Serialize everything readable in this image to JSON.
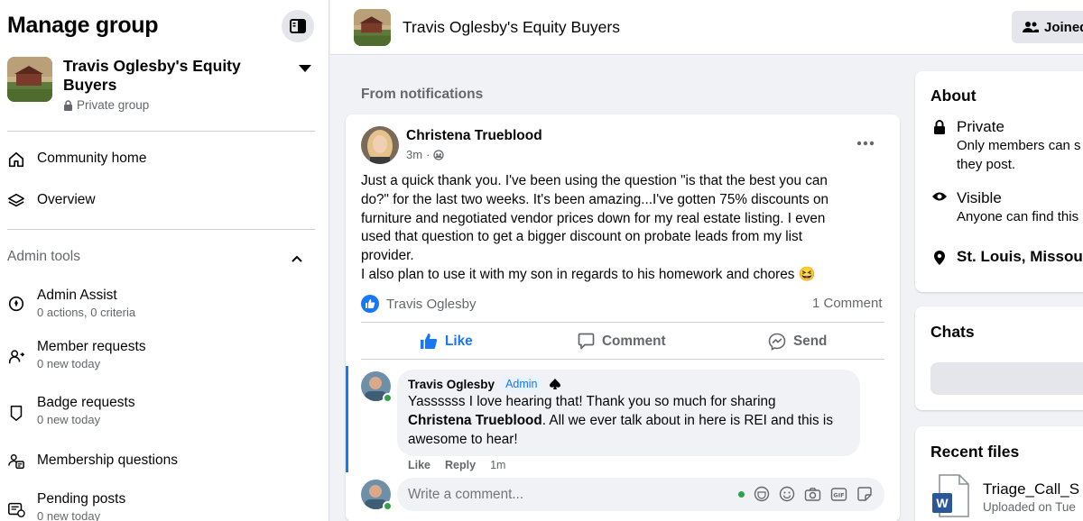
{
  "sidebar": {
    "title": "Manage group",
    "group_name": "Travis Oglesby's Equity Buyers",
    "privacy": "Private group",
    "nav": [
      {
        "label": "Community home"
      },
      {
        "label": "Overview"
      }
    ],
    "admin_section": "Admin tools",
    "admin_items": [
      {
        "label": "Admin Assist",
        "sub": "0 actions, 0 criteria"
      },
      {
        "label": "Member requests",
        "sub": "0 new today"
      },
      {
        "label": "Badge requests",
        "sub": "0 new today"
      },
      {
        "label": "Membership questions",
        "sub": ""
      },
      {
        "label": "Pending posts",
        "sub": "0 new today"
      }
    ]
  },
  "header": {
    "group_title": "Travis Oglesby's Equity Buyers",
    "joined_label": "Joined"
  },
  "feed": {
    "section_label": "From notifications",
    "post": {
      "author": "Christena Trueblood",
      "time": "3m",
      "dot": "·",
      "body_lines": [
        "Just a quick thank you. I've been using the question \"is that the best you can",
        "do?\" for the last two weeks. It's been amazing...I've gotten 75% discounts on",
        "furniture and negotiated vendor prices down for my real estate listing. I even",
        "used that question to get a bigger discount on probate leads from my list",
        "provider.",
        "I also plan to use it with my son in regards to his homework and chores 😆"
      ],
      "reactor": "Travis Oglesby",
      "comment_count": "1 Comment",
      "actions": {
        "like": "Like",
        "comment": "Comment",
        "send": "Send"
      },
      "comment": {
        "author": "Travis Oglesby",
        "badge": "Admin",
        "text_pre": "Yassssss I love hearing that! Thank you so much for sharing",
        "mention": "Christena Trueblood",
        "text_post": ". All we ever talk about in here is REI and this is",
        "text_end": "awesome to hear!",
        "like": "Like",
        "reply": "Reply",
        "time": "1m"
      },
      "write_placeholder": "Write a comment..."
    }
  },
  "right": {
    "about_title": "About",
    "private_title": "Private",
    "private_desc_1": "Only members can s",
    "private_desc_2": "they post.",
    "visible_title": "Visible",
    "visible_desc": "Anyone can find this",
    "location": "St. Louis, Missou",
    "chats_title": "Chats",
    "files_title": "Recent files",
    "file_name": "Triage_Call_S",
    "file_sub": "Uploaded on Tue",
    "file_badge": "W"
  },
  "colors": {
    "accent": "#1877f2",
    "online": "#31a24c",
    "muted": "#65676b"
  }
}
